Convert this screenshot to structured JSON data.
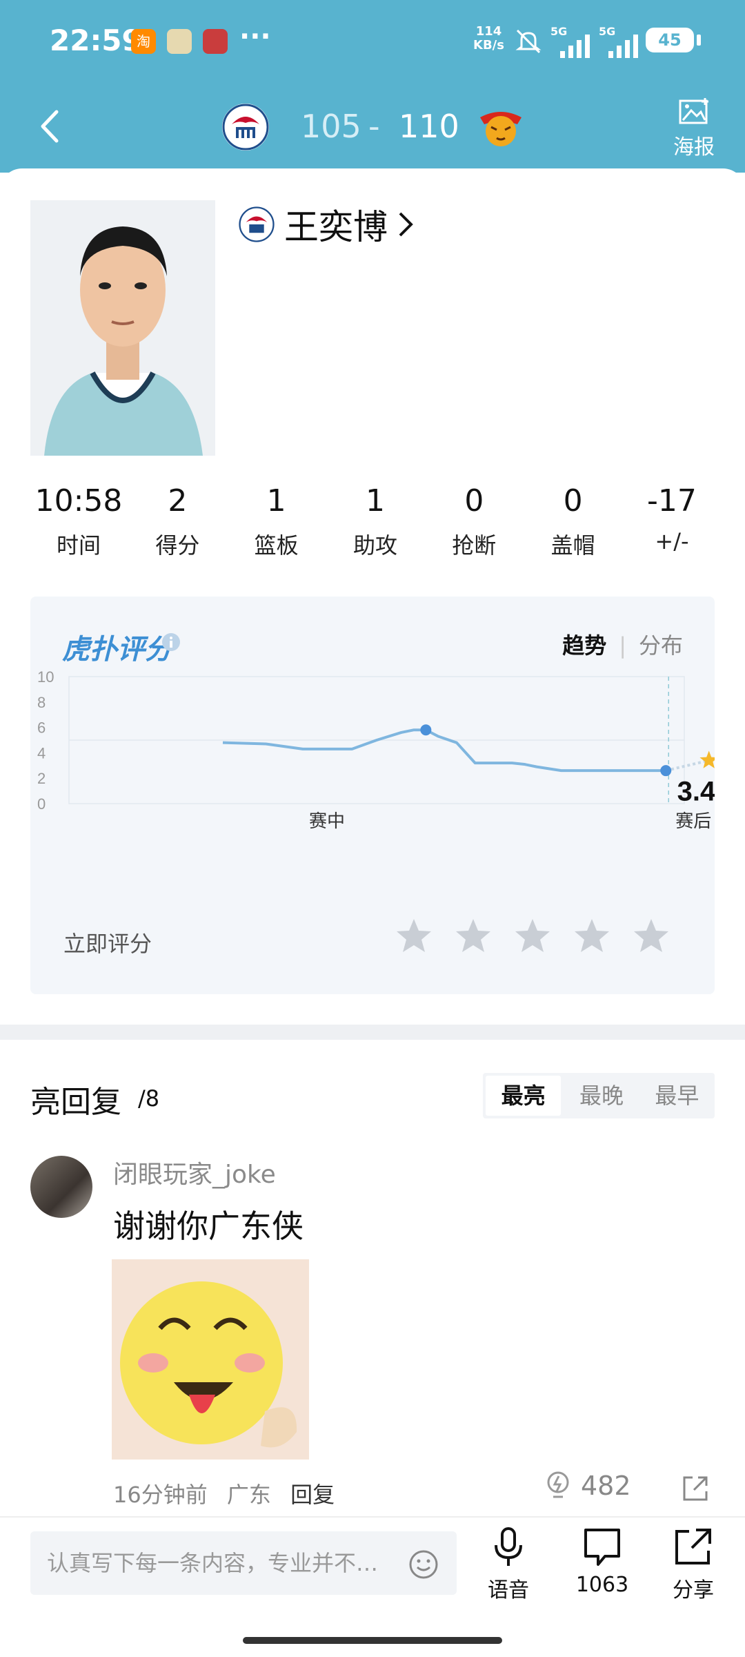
{
  "status_bar": {
    "time": "22:59",
    "net_speed_value": "114",
    "net_speed_unit": "KB/s",
    "sig1": "5G",
    "sig2": "5G",
    "battery": "45"
  },
  "header": {
    "home_score": "105",
    "separator": "-",
    "away_score": "110",
    "poster_label": "海报",
    "accent_color": "#58b3cf"
  },
  "player": {
    "name": "王奕博"
  },
  "stats": [
    {
      "value": "10:58",
      "label": "时间"
    },
    {
      "value": "2",
      "label": "得分"
    },
    {
      "value": "1",
      "label": "篮板"
    },
    {
      "value": "1",
      "label": "助攻"
    },
    {
      "value": "0",
      "label": "抢断"
    },
    {
      "value": "0",
      "label": "盖帽"
    },
    {
      "value": "-17",
      "label": "+/-"
    }
  ],
  "rating": {
    "logo": "虎扑评分",
    "tab_trend": "趋势",
    "tab_dist": "分布",
    "final_score": "3.4",
    "rate_now": "立即评分",
    "star_count": 5
  },
  "chart_data": {
    "type": "line",
    "ylim": [
      0,
      10
    ],
    "yticks": [
      "0",
      "2",
      "4",
      "6",
      "8",
      "10"
    ],
    "x_labels": [
      "赛中",
      "赛后"
    ],
    "series": [
      {
        "x": [
          0.25,
          0.32,
          0.38,
          0.42,
          0.46,
          0.5,
          0.54,
          0.56,
          0.58,
          0.6,
          0.63,
          0.66,
          0.68,
          0.7,
          0.72,
          0.74,
          0.76,
          0.8,
          0.83,
          0.86,
          0.9,
          0.94,
          0.97
        ],
        "values": [
          4.8,
          4.7,
          4.3,
          4.3,
          4.3,
          5.0,
          5.6,
          5.8,
          5.8,
          5.3,
          4.8,
          3.2,
          3.2,
          3.2,
          3.2,
          3.1,
          2.9,
          2.6,
          2.6,
          2.6,
          2.6,
          2.6,
          2.6
        ]
      }
    ],
    "markers": [
      {
        "x": 0.58,
        "y": 5.8
      },
      {
        "x": 0.97,
        "y": 2.6
      }
    ],
    "final_star": {
      "x": 1.04,
      "y": 3.4
    }
  },
  "replies": {
    "title": "亮回复",
    "count": "/8",
    "sort_options": [
      "最亮",
      "最晚",
      "最早"
    ],
    "items": [
      {
        "user": "闭眼玩家_joke",
        "text": "谢谢你广东侠",
        "time": "16分钟前",
        "location": "广东",
        "reply_label": "回复",
        "likes": "482"
      }
    ]
  },
  "bottom_bar": {
    "input_placeholder": "认真写下每一条内容，专业并不…",
    "voice_label": "语音",
    "comments_count": "1063",
    "share_label": "分享"
  }
}
